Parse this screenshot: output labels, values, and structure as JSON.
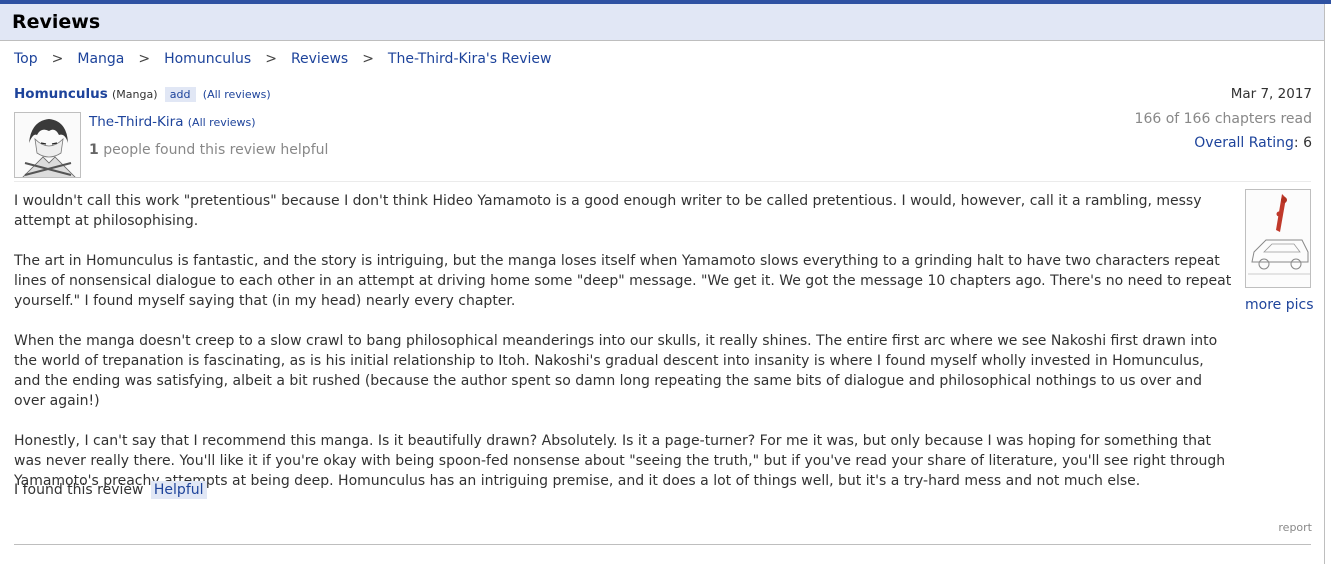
{
  "page": {
    "title": "Reviews"
  },
  "breadcrumb": {
    "items": [
      "Top",
      "Manga",
      "Homunculus",
      "Reviews",
      "The-Third-Kira's Review"
    ],
    "separator": ">"
  },
  "entry": {
    "title": "Homunculus",
    "type": "(Manga)",
    "add_label": "add",
    "all_reviews_label": "(All reviews)"
  },
  "reviewer": {
    "name": "The-Third-Kira",
    "all_reviews_label": "(All reviews)",
    "helpful_count": "1",
    "helpful_text": "people found this review helpful"
  },
  "meta": {
    "date": "Mar 7, 2017",
    "progress": "166 of 166 chapters read",
    "rating_label": "Overall Rating",
    "rating_value": "6"
  },
  "review": {
    "paragraphs": [
      "I wouldn't call this work \"pretentious\" because I don't think Hideo Yamamoto is a good enough writer to be called pretentious. I would, however, call it a rambling, messy attempt at philosophising.",
      "The art in Homunculus is fantastic, and the story is intriguing, but the manga loses itself when Yamamoto slows everything to a grinding halt to have two characters repeat lines of nonsensical dialogue to each other in an attempt at driving home some \"deep\" message. \"We get it. We got the message 10 chapters ago. There's no need to repeat yourself.\" I found myself saying that (in my head) nearly every chapter.",
      "When the manga doesn't creep to a slow crawl to bang philosophical meanderings into our skulls, it really shines. The entire first arc where we see Nakoshi first drawn into the world of trepanation is fascinating, as is his initial relationship to Itoh. Nakoshi's gradual descent into insanity is where I found myself wholly invested in Homunculus, and the ending was satisfying, albeit a bit rushed (because the author spent so damn long repeating the same bits of dialogue and philosophical nothings to us over and over again!)",
      "Honestly, I can't say that I recommend this manga. Is it beautifully drawn? Absolutely. Is it a page-turner? For me it was, but only because I was hoping for something that was never really there. You'll like it if you're okay with being spoon-fed nonsense about \"seeing the truth,\" but if you've read your share of literature, you'll see right through Yamamoto's preachy attempts at being deep. Homunculus has an intriguing premise, and it does a lot of things well, but it's a try-hard mess and not much else."
    ],
    "more_pics_label": "more pics",
    "found_helpful_text": "I found this review",
    "helpful_button": "Helpful",
    "report_label": "report"
  },
  "colors": {
    "accent": "#2e51a2",
    "link": "#1d439b",
    "header_bg": "#e1e7f5"
  },
  "icons": {
    "avatar": "avatar-image",
    "cover": "manga-cover-thumbnail"
  }
}
